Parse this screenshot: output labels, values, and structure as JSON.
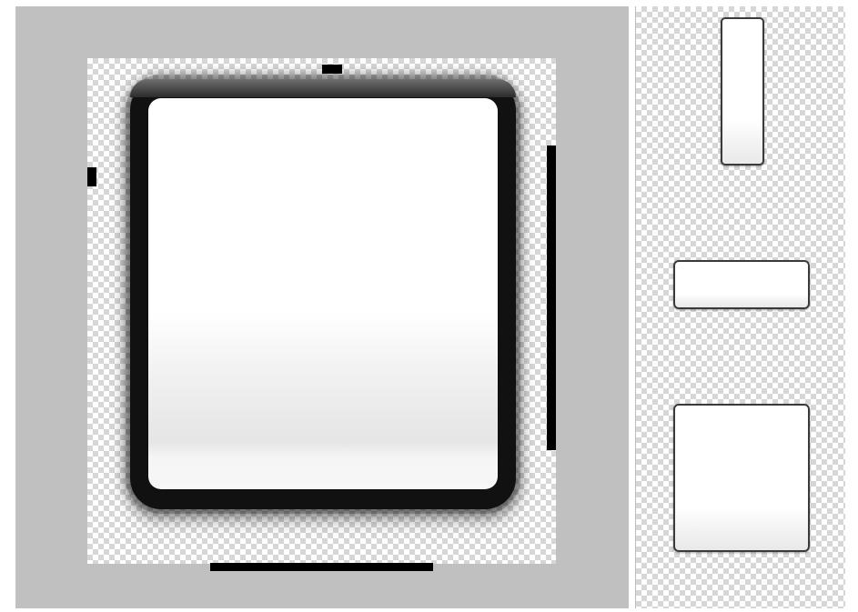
{
  "app": {
    "name": ""
  },
  "editor": {
    "workspace_color": "#c0c0c0",
    "checker_colors": [
      "#ffffff",
      "#d6d6d6"
    ],
    "patch_fill_colors": [
      "#ffffff",
      "#e6e6e6"
    ],
    "patch_border_color": "#111111",
    "guide_color": "#000000",
    "guides": [
      {
        "name": "stretch-guide-top",
        "edge": "top",
        "role": "horizontal stretch region marker"
      },
      {
        "name": "stretch-guide-left",
        "edge": "left",
        "role": "vertical stretch region marker"
      },
      {
        "name": "content-guide-right",
        "edge": "right",
        "role": "vertical content padding marker"
      },
      {
        "name": "content-guide-bottom",
        "edge": "bottom",
        "role": "horizontal content padding marker"
      }
    ]
  },
  "preview": {
    "tiles": [
      {
        "name": "preview-tall",
        "shape": "tall"
      },
      {
        "name": "preview-wide",
        "shape": "wide"
      },
      {
        "name": "preview-square",
        "shape": "square"
      }
    ]
  }
}
